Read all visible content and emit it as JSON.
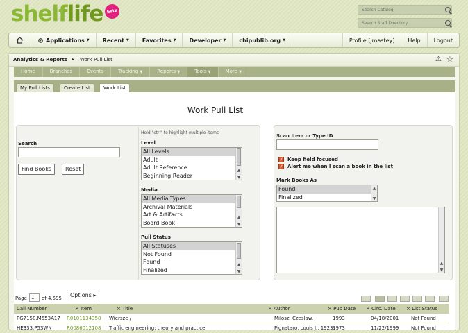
{
  "header": {
    "logo_shelf": "shelf",
    "logo_life": "life",
    "beta": "beta",
    "search_catalog_placeholder": "Search Catalog",
    "search_staff_placeholder": "Search Staff Directory"
  },
  "nav": {
    "items": [
      {
        "label": "Applications"
      },
      {
        "label": "Recent"
      },
      {
        "label": "Favorites"
      },
      {
        "label": "Developer"
      },
      {
        "label": "chipublib.org"
      }
    ],
    "profile": "Profile [jmastey]",
    "help": "Help",
    "logout": "Logout"
  },
  "breadcrumb": {
    "section": "Analytics & Reports",
    "page": "Work Pull List"
  },
  "subnav": [
    "Home",
    "Branches",
    "Events",
    "Tracking",
    "Reports",
    "Tools",
    "More"
  ],
  "tabs": [
    "My Pull Lists",
    "Create List",
    "Work List"
  ],
  "page_title": "Work Pull List",
  "left_form": {
    "hint": "Hold \"ctrl\" to highlight multiple items",
    "search_label": "Search",
    "find_button": "Find Books",
    "reset_button": "Reset",
    "level_label": "Level",
    "level_options": [
      "All Levels",
      "Adult",
      "Adult Reference",
      "Beginning Reader"
    ],
    "media_label": "Media",
    "media_options": [
      "All Media Types",
      "Archival Materials",
      "Art & Artifacts",
      "Board Book"
    ],
    "status_label": "Pull Status",
    "status_options": [
      "All Statuses",
      "Not Found",
      "Found",
      "Finalized"
    ]
  },
  "right_form": {
    "scan_label": "Scan Item or Type ID",
    "keep_focus": "Keep field focused",
    "alert": "Alert me when I scan a book in the list",
    "mark_label": "Mark Books As",
    "mark_options": [
      "Found",
      "Finalized"
    ]
  },
  "pagination": {
    "page_label": "Page",
    "page_value": "1",
    "of_label": "of 4,595",
    "options_button": "Options"
  },
  "table": {
    "columns": [
      "Call Number",
      "Item",
      "Title",
      "Author",
      "Pub Date",
      "Circ. Date",
      "List Status"
    ],
    "rows": [
      [
        "PG7158.M553A17",
        "R0101134358",
        "Wiersze /",
        "Milosz, Czeslaw.",
        "1993",
        "04/18/2001",
        "Not Found"
      ],
      [
        "HE333.P53WN",
        "R0086012108",
        "Traffic engineering: theory and practice",
        "Pignataro, Louis J., 1923-",
        "1973",
        "11/22/1999",
        "Not Found"
      ]
    ]
  },
  "colors": {
    "green": "#8ab833",
    "beta": "#e0217d",
    "subnav": "#a8b288"
  }
}
